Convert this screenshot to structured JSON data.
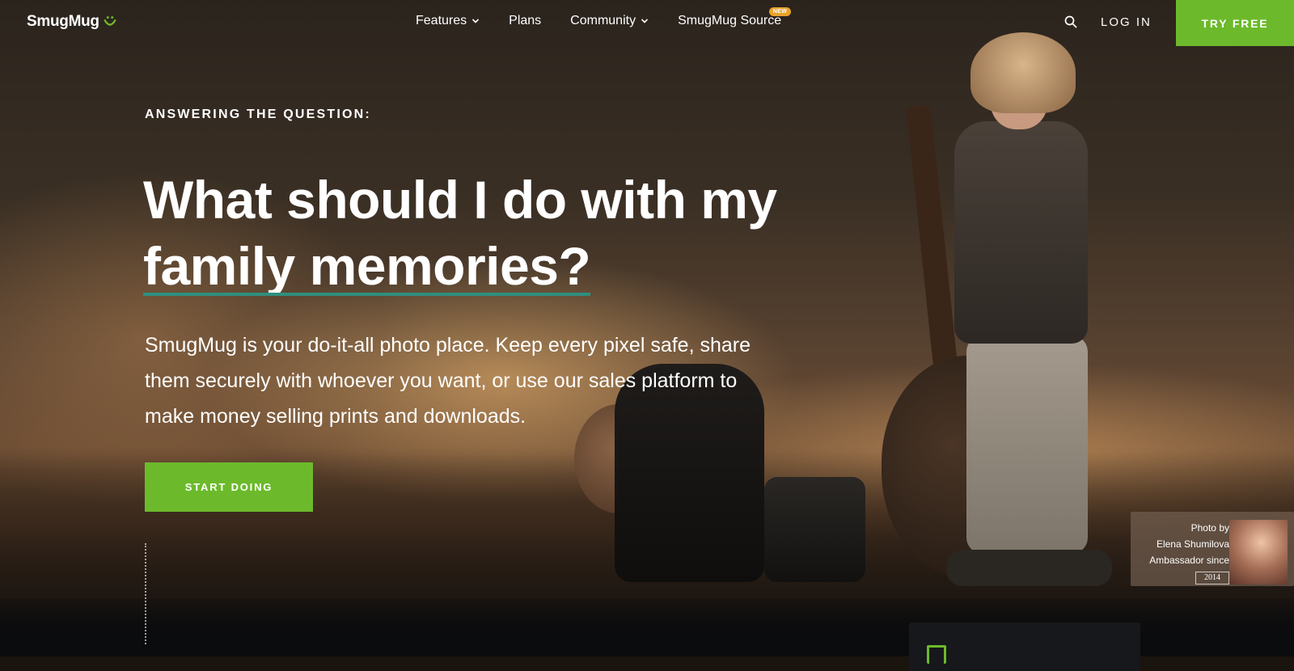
{
  "brand": {
    "name": "SmugMug",
    "accent_color": "#6cba2b"
  },
  "nav": {
    "items": [
      {
        "label": "Features",
        "has_dropdown": true
      },
      {
        "label": "Plans",
        "has_dropdown": false
      },
      {
        "label": "Community",
        "has_dropdown": true
      },
      {
        "label": "SmugMug Source",
        "has_dropdown": false,
        "badge": "NEW"
      }
    ],
    "search_icon": "search-icon",
    "login_label": "LOG IN",
    "cta_label": "TRY FREE"
  },
  "hero": {
    "eyebrow": "ANSWERING THE QUESTION:",
    "headline_line1": "What should I do with my",
    "headline_line2": "family memories?",
    "subcopy": "SmugMug is your do-it-all photo place. Keep every pixel safe, share them securely with whoever you want, or use our sales platform to make money selling prints and downloads.",
    "cta_label": "START DOING"
  },
  "photo_credit": {
    "line1": "Photo by",
    "photographer": "Elena Shumilova",
    "line3": "Ambassador since",
    "year": "2014"
  }
}
